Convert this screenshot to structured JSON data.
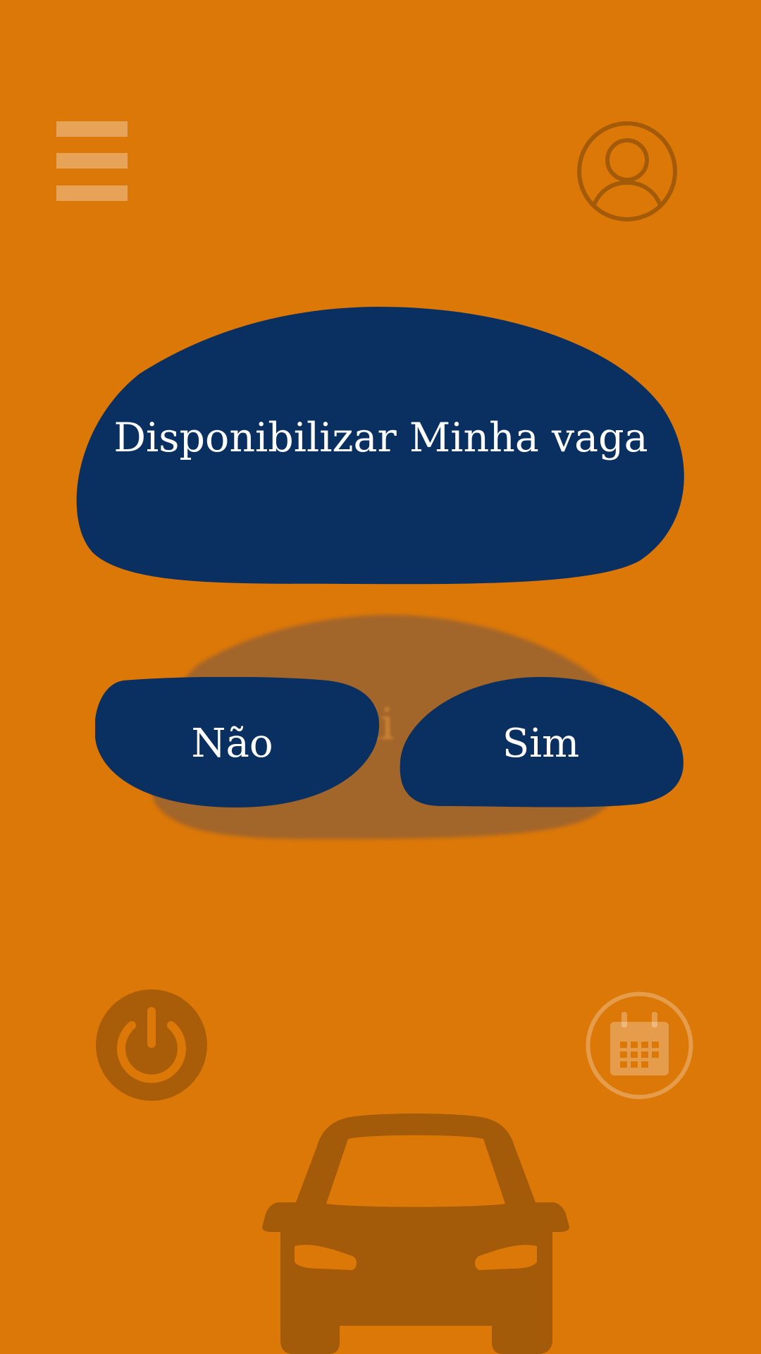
{
  "colors": {
    "background": "#DC7808",
    "button": "#0A3061",
    "button_text": "#FFFFFF",
    "icon_dark": "#A35A09"
  },
  "header": {
    "menu_icon": "hamburger-menu-icon",
    "profile_icon": "user-circle-icon"
  },
  "dialog": {
    "title": "Disponibilizar Minha vaga",
    "no_label": "Não",
    "yes_label": "Sim"
  },
  "background_layer": {
    "partial_text": "di"
  },
  "footer": {
    "power_icon": "power-icon",
    "calendar_icon": "calendar-icon",
    "car_icon": "car-icon"
  }
}
